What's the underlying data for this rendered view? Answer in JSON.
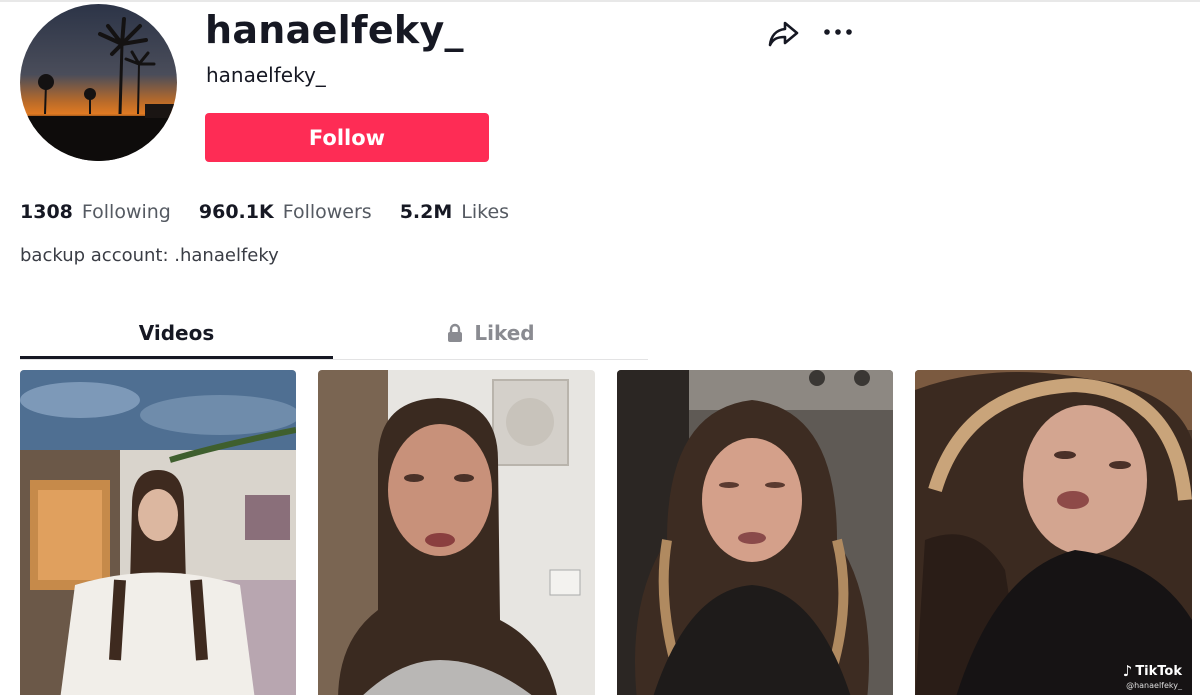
{
  "profile": {
    "display_name": "hanaelfeky_",
    "username": "hanaelfeky_",
    "follow_label": "Follow",
    "bio": "backup account: .hanaelfeky",
    "avatar_icon": "sunset-palm-avatar"
  },
  "actions": {
    "share_icon": "share-arrow-icon",
    "more_icon": "more-dots-icon"
  },
  "stats": [
    {
      "value": "1308",
      "label": "Following"
    },
    {
      "value": "960.1K",
      "label": "Followers"
    },
    {
      "value": "5.2M",
      "label": "Likes"
    }
  ],
  "tabs": [
    {
      "label": "Videos",
      "active": true
    },
    {
      "label": "Liked",
      "icon": "lock-icon",
      "active": false
    }
  ],
  "watermark": {
    "brand": "TikTok",
    "handle": "@hanaelfeky_"
  },
  "colors": {
    "accent": "#fe2c55",
    "text_primary": "#161823",
    "text_secondary": "#555a62",
    "tab_inactive": "#8a8b91"
  }
}
